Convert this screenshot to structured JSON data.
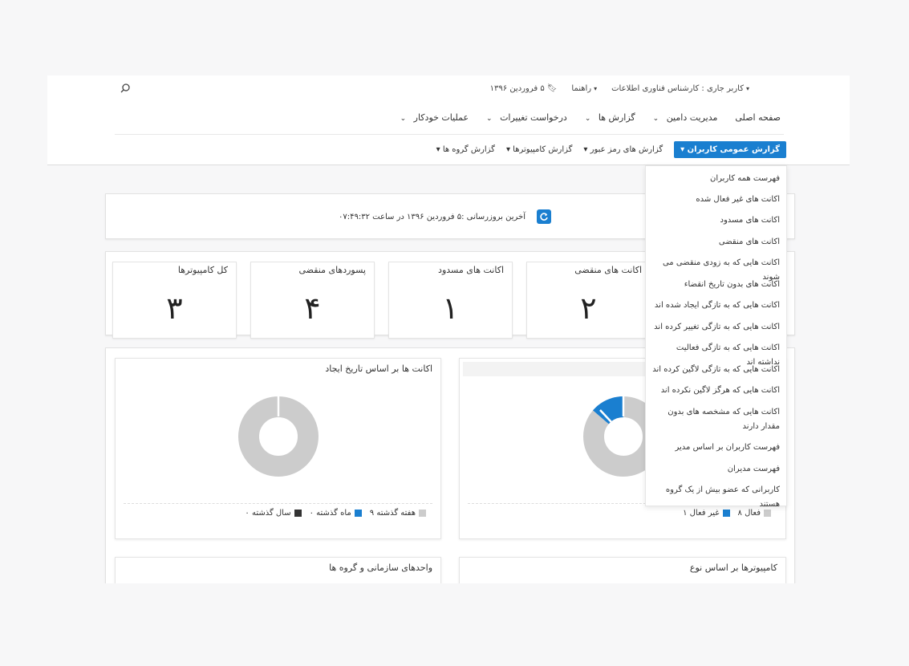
{
  "header": {
    "current_user": "کاربر جاری : کارشناس فناوری اطلاعات",
    "help": "راهنما",
    "date": "۵ فروردین ۱۳۹۶"
  },
  "main_nav": [
    "صفحه اصلی",
    "مدیریت دامین",
    "گزارش ها",
    "درخواست تغییرات",
    "عملیات خودکار"
  ],
  "sub_nav": {
    "active": "گزارش عمومی کاربران",
    "items": [
      "گزارش های رمز عبور",
      "گزارش کامپیوترها",
      "گزارش گروه ها"
    ]
  },
  "update_bar": {
    "text": "آخرین بروزرسانی :۵ فروردین ۱۳۹۶ در ساعت ۰۷:۴۹:۳۲"
  },
  "stats": [
    {
      "label": "اکانت های منقضی",
      "value": "۲"
    },
    {
      "label": "اکانت های مسدود",
      "value": "۱"
    },
    {
      "label": "پسوردهای منقضی",
      "value": "۴"
    },
    {
      "label": "کل کامپیوترها",
      "value": "۳"
    }
  ],
  "charts": {
    "left": {
      "title": "اکانت ها بر اساس تاریخ ایجاد",
      "legend": [
        {
          "label": "هفته گذشته",
          "value": "۹",
          "color": "#cccccc"
        },
        {
          "label": "ماه گذشته",
          "value": "۰",
          "color": "#1a7fd0"
        },
        {
          "label": "سال گذشته",
          "value": "۰",
          "color": "#333333"
        }
      ]
    },
    "right": {
      "legend": [
        {
          "label": "فعال",
          "value": "۸",
          "color": "#cccccc"
        },
        {
          "label": "غیر فعال",
          "value": "۱",
          "color": "#1a7fd0"
        }
      ]
    },
    "bottom_left_title": "واحدهای سازمانی و گروه ها",
    "bottom_right_title": "کامپیوترها بر اساس نوع"
  },
  "chart_data": [
    {
      "type": "pie",
      "categories": [
        "هفته گذشته",
        "ماه گذشته",
        "سال گذشته"
      ],
      "values": [
        9,
        0,
        0
      ],
      "title": "اکانت ها بر اساس تاریخ ایجاد"
    },
    {
      "type": "pie",
      "categories": [
        "فعال",
        "غیر فعال"
      ],
      "values": [
        8,
        1
      ]
    }
  ],
  "dropdown": [
    "فهرست همه کاربران",
    "اکانت های غیر فعال شده",
    "اکانت های مسدود",
    "اکانت های منقضی",
    "اکانت هایی که به زودی منقضی می شوند",
    "اکانت های بدون تاریخ انقضاء",
    "اکانت هایی که به تازگی ایجاد شده اند",
    "اکانت هایی که به تازگی تغییر کرده اند",
    "اکانت هایی که به تازگی فعالیت نداشته اند",
    "اکانت هایی که به تازگی لاگین کرده اند",
    "اکانت هایی که هرگز لاگین نکرده اند",
    "اکانت هایی که مشخصه های بدون مقدار دارند",
    "فهرست کاربران بر اساس مدیر",
    "فهرست مدیران",
    "کاربرانی که عضو بیش از یک گروه هستند"
  ],
  "icons": {
    "search": "search-icon",
    "refresh": "refresh-icon",
    "bookmark": "bookmark-icon"
  }
}
